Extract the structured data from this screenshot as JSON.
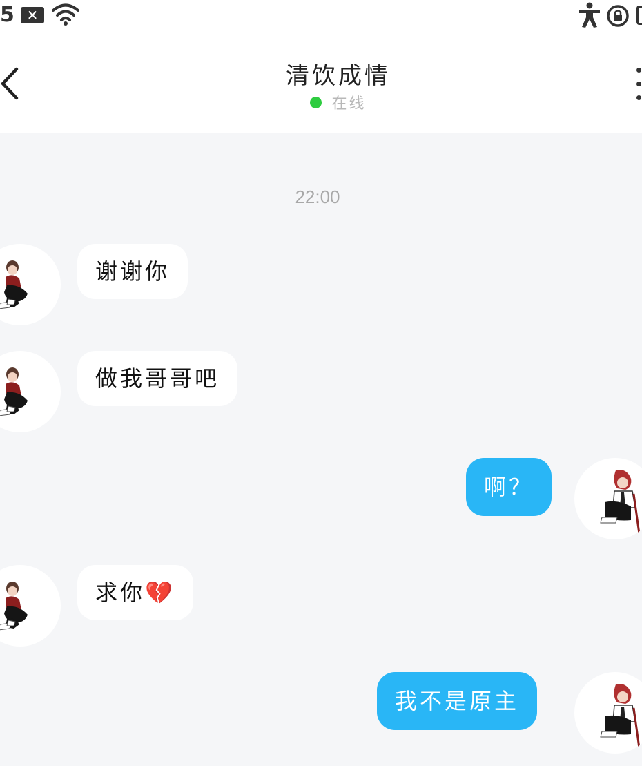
{
  "status_bar": {
    "time_fragment": "5",
    "icons": [
      "notification-x-icon",
      "wifi-icon",
      "accessibility-icon",
      "lock-rotation-icon",
      "battery-icon"
    ]
  },
  "header": {
    "title": "清饮成情",
    "status": "在线",
    "status_color": "#2ecc40"
  },
  "chat": {
    "timestamp": "22:00",
    "messages": [
      {
        "side": "left",
        "text": "谢谢你"
      },
      {
        "side": "left",
        "text": "做我哥哥吧"
      },
      {
        "side": "right",
        "text": "啊？"
      },
      {
        "side": "left",
        "text": "求你💔"
      },
      {
        "side": "right",
        "text": "我不是原主"
      }
    ]
  },
  "colors": {
    "background": "#f5f6f8",
    "bubble_right": "#29b6f6",
    "bubble_left": "#ffffff"
  }
}
